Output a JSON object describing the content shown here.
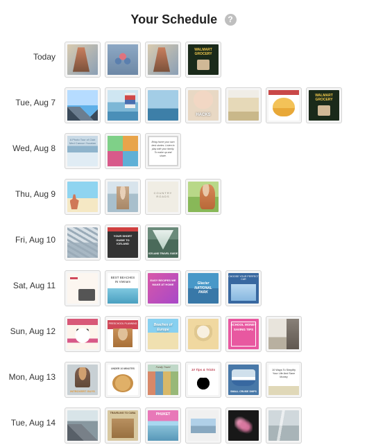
{
  "header": {
    "title": "Your Schedule",
    "help_glyph": "?"
  },
  "days": [
    {
      "label": "Today",
      "count": 4
    },
    {
      "label": "Tue, Aug 7",
      "count": 7
    },
    {
      "label": "Wed, Aug 8",
      "count": 3
    },
    {
      "label": "Thu, Aug 9",
      "count": 4
    },
    {
      "label": "Fri, Aug 10",
      "count": 3
    },
    {
      "label": "Sat, Aug 11",
      "count": 5
    },
    {
      "label": "Sun, Aug 12",
      "count": 6
    },
    {
      "label": "Mon, Aug 13",
      "count": 6
    },
    {
      "label": "Tue, Aug 14",
      "count": 6
    }
  ],
  "thumbs": [
    [
      "v0",
      "v1",
      "v0",
      "v2"
    ],
    [
      "v3",
      "v4",
      "v5",
      "v6",
      "v7",
      "v8",
      "v2"
    ],
    [
      "v9",
      "v10",
      "v11"
    ],
    [
      "v12",
      "v13",
      "v14",
      "v15"
    ],
    [
      "v16",
      "v17",
      "v18"
    ],
    [
      "v19",
      "v20",
      "v21",
      "v22",
      "v23"
    ],
    [
      "v24",
      "v25",
      "v26",
      "v27",
      "v28",
      "v29"
    ],
    [
      "v30",
      "v31",
      "v32",
      "v33",
      "v34",
      "v35"
    ],
    [
      "v36",
      "v37",
      "v38",
      "v39",
      "v40",
      "v41"
    ]
  ]
}
